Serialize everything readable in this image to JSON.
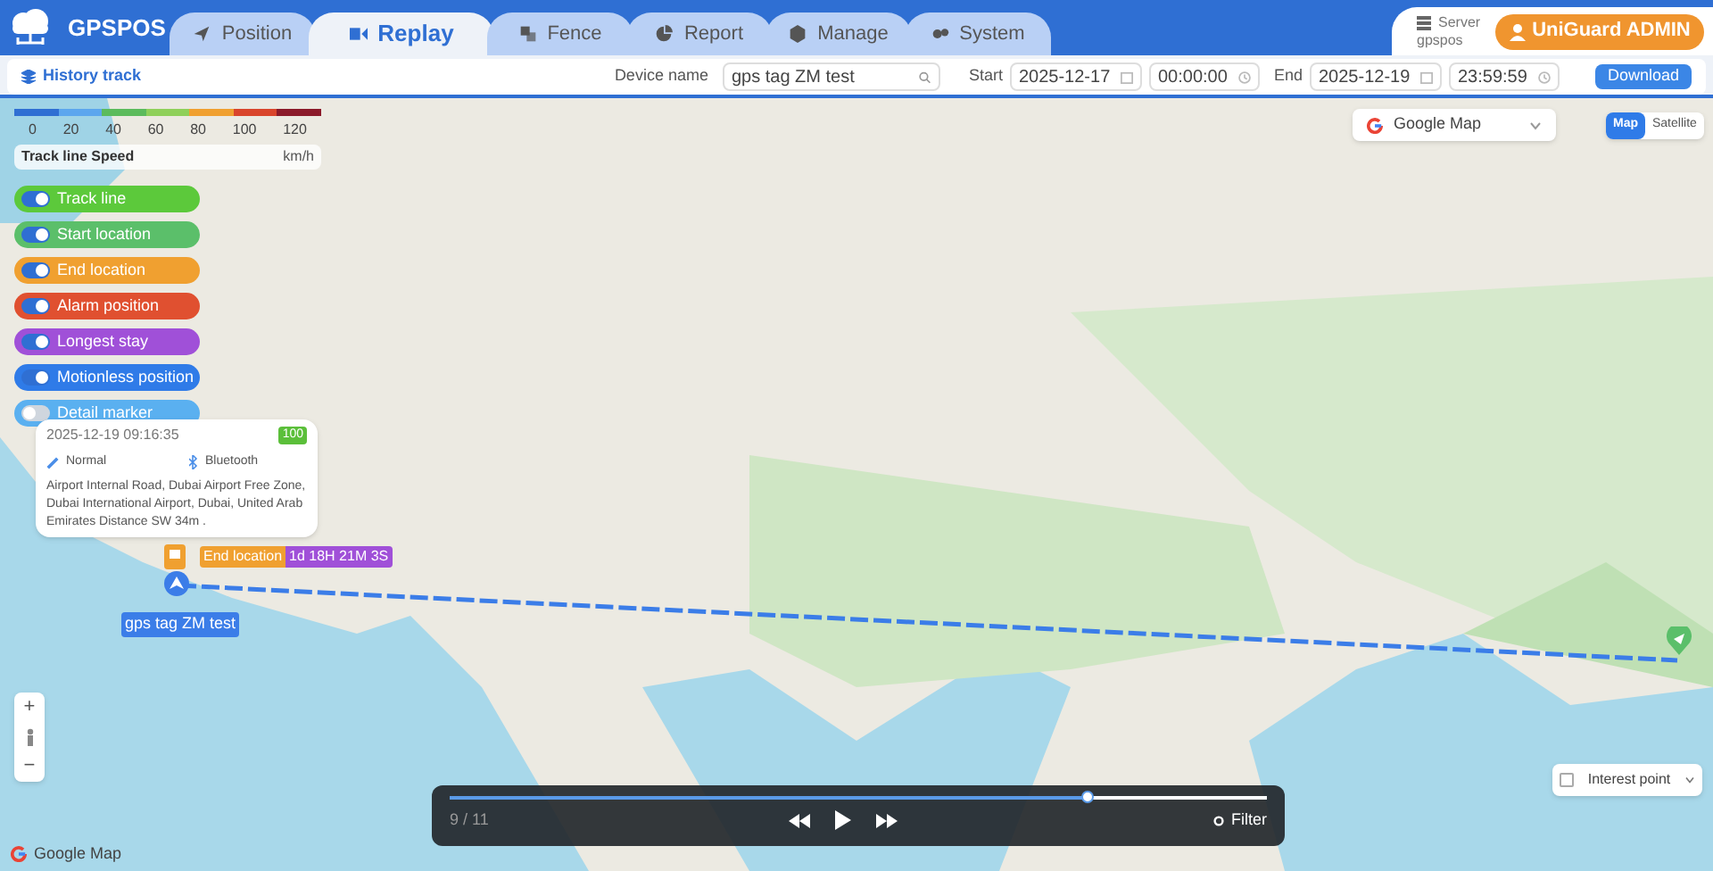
{
  "header": {
    "logo_text": "GPSPOS",
    "tabs": [
      {
        "label": "Position",
        "selected": false,
        "kind": "position"
      },
      {
        "label": "Replay",
        "selected": true,
        "kind": "replay"
      },
      {
        "label": "Fence",
        "selected": false,
        "kind": "fence"
      },
      {
        "label": "Report",
        "selected": false,
        "kind": "report"
      },
      {
        "label": "Manage",
        "selected": false,
        "kind": "manage"
      },
      {
        "label": "System",
        "selected": false,
        "kind": "system"
      }
    ],
    "server": {
      "label": "Server",
      "value": "gpspos"
    },
    "user": "UniGuard ADMIN"
  },
  "toolbar": {
    "title": "History track",
    "device_label": "Device name",
    "device_value": "gps tag ZM test",
    "start_label": "Start",
    "start_date": "2025-12-17",
    "start_time": "00:00:00",
    "end_label": "End",
    "end_date": "2025-12-19",
    "end_time": "23:59:59",
    "download": "Download"
  },
  "map": {
    "speed_legend": {
      "ticks": [
        "0",
        "20",
        "40",
        "60",
        "80",
        "100",
        "120"
      ],
      "unit": "km/h",
      "title": "Track line Speed"
    },
    "layers": [
      {
        "label": "Track line",
        "on": true,
        "color": "#5cc93b"
      },
      {
        "label": "Start location",
        "on": true,
        "color": "#5bbf6a"
      },
      {
        "label": "End location",
        "on": true,
        "color": "#f0a030"
      },
      {
        "label": "Alarm position",
        "on": true,
        "color": "#e05030"
      },
      {
        "label": "Longest stay",
        "on": true,
        "color": "#a050d8"
      },
      {
        "label": "Motionless position",
        "on": true,
        "color": "#2f7be8"
      },
      {
        "label": "Detail marker",
        "on": false,
        "color": "#5ab0f0"
      }
    ],
    "popup": {
      "time": "2025-12-19 09:16:35",
      "battery": "100",
      "mode": "Normal",
      "connection": "Bluetooth",
      "address": "Airport Internal Road, Dubai Airport Free Zone, Dubai International Airport, Dubai, United Arab Emirates Distance SW 34m ."
    },
    "end_badge": "End location",
    "stay_badge": "1d 18H 21M 3S",
    "device_label": "gps tag ZM test",
    "map_type": "Google Map",
    "map_toggle": [
      {
        "label": "Map",
        "selected": true
      },
      {
        "label": "Satellite",
        "selected": false
      }
    ],
    "zoom": {
      "in": "+",
      "out": "−"
    },
    "interest_point": {
      "label": "Interest point",
      "checked": false
    },
    "attribution": "Google Map"
  },
  "playback": {
    "level": 0.78,
    "counter": "9 / 11",
    "filter": "Filter"
  }
}
